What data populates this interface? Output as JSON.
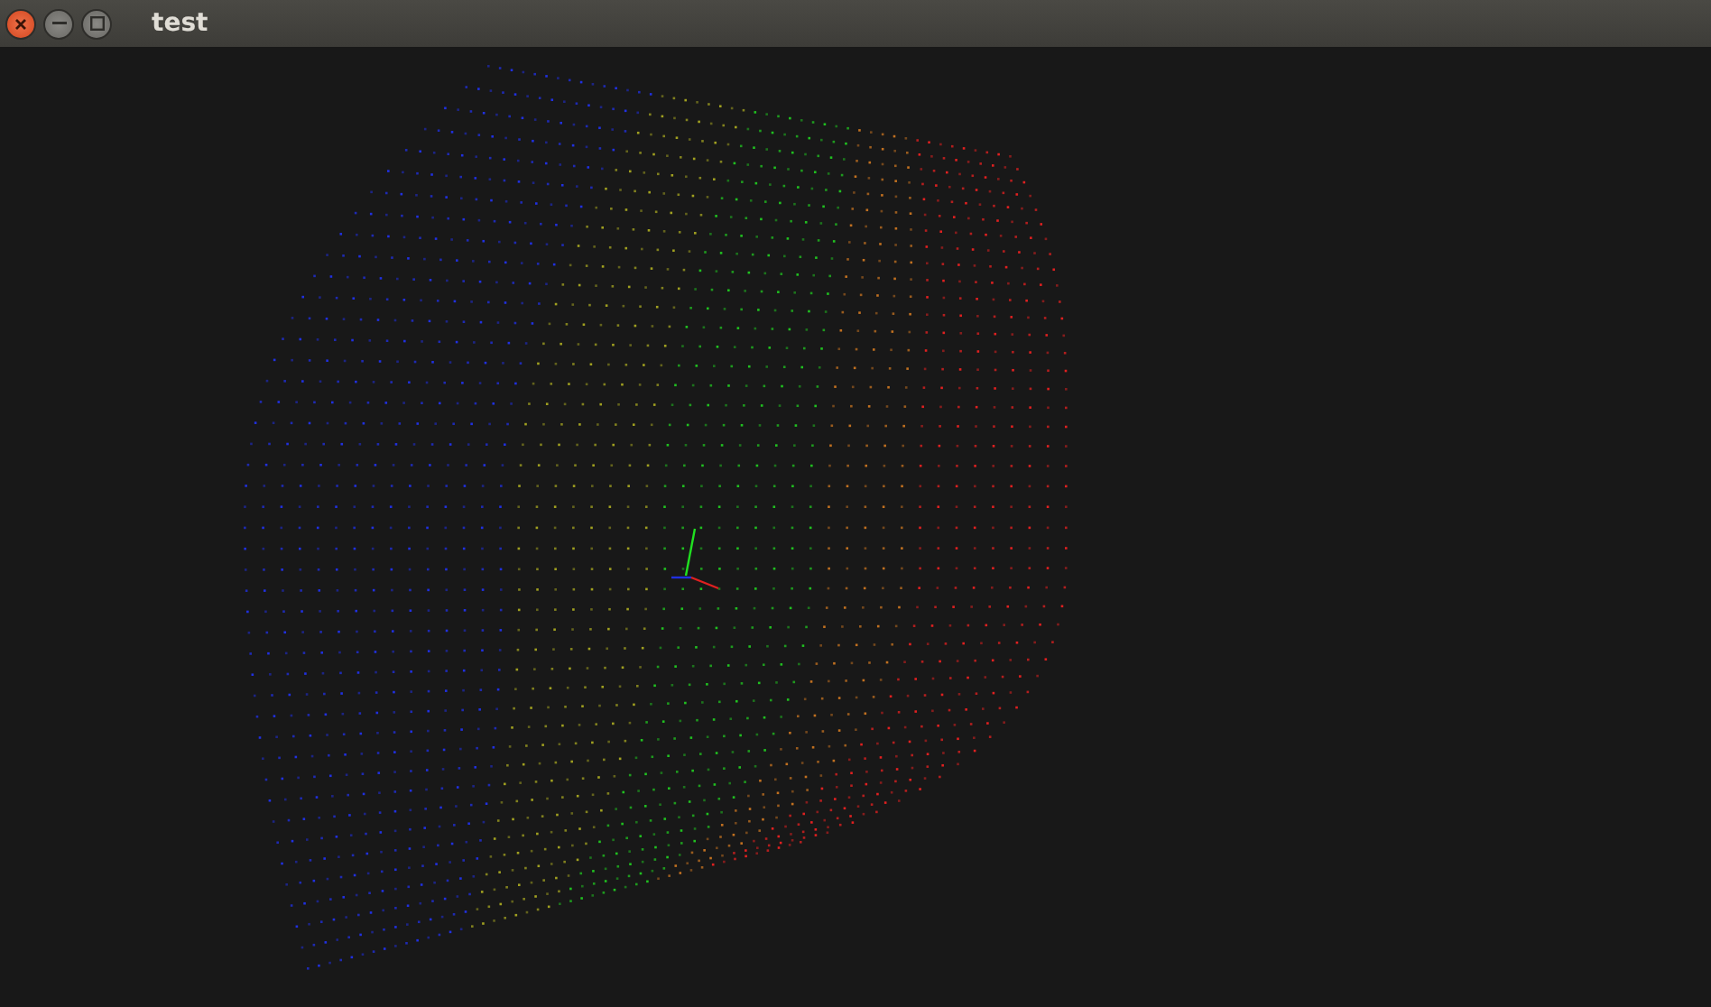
{
  "window": {
    "title": "test"
  }
}
